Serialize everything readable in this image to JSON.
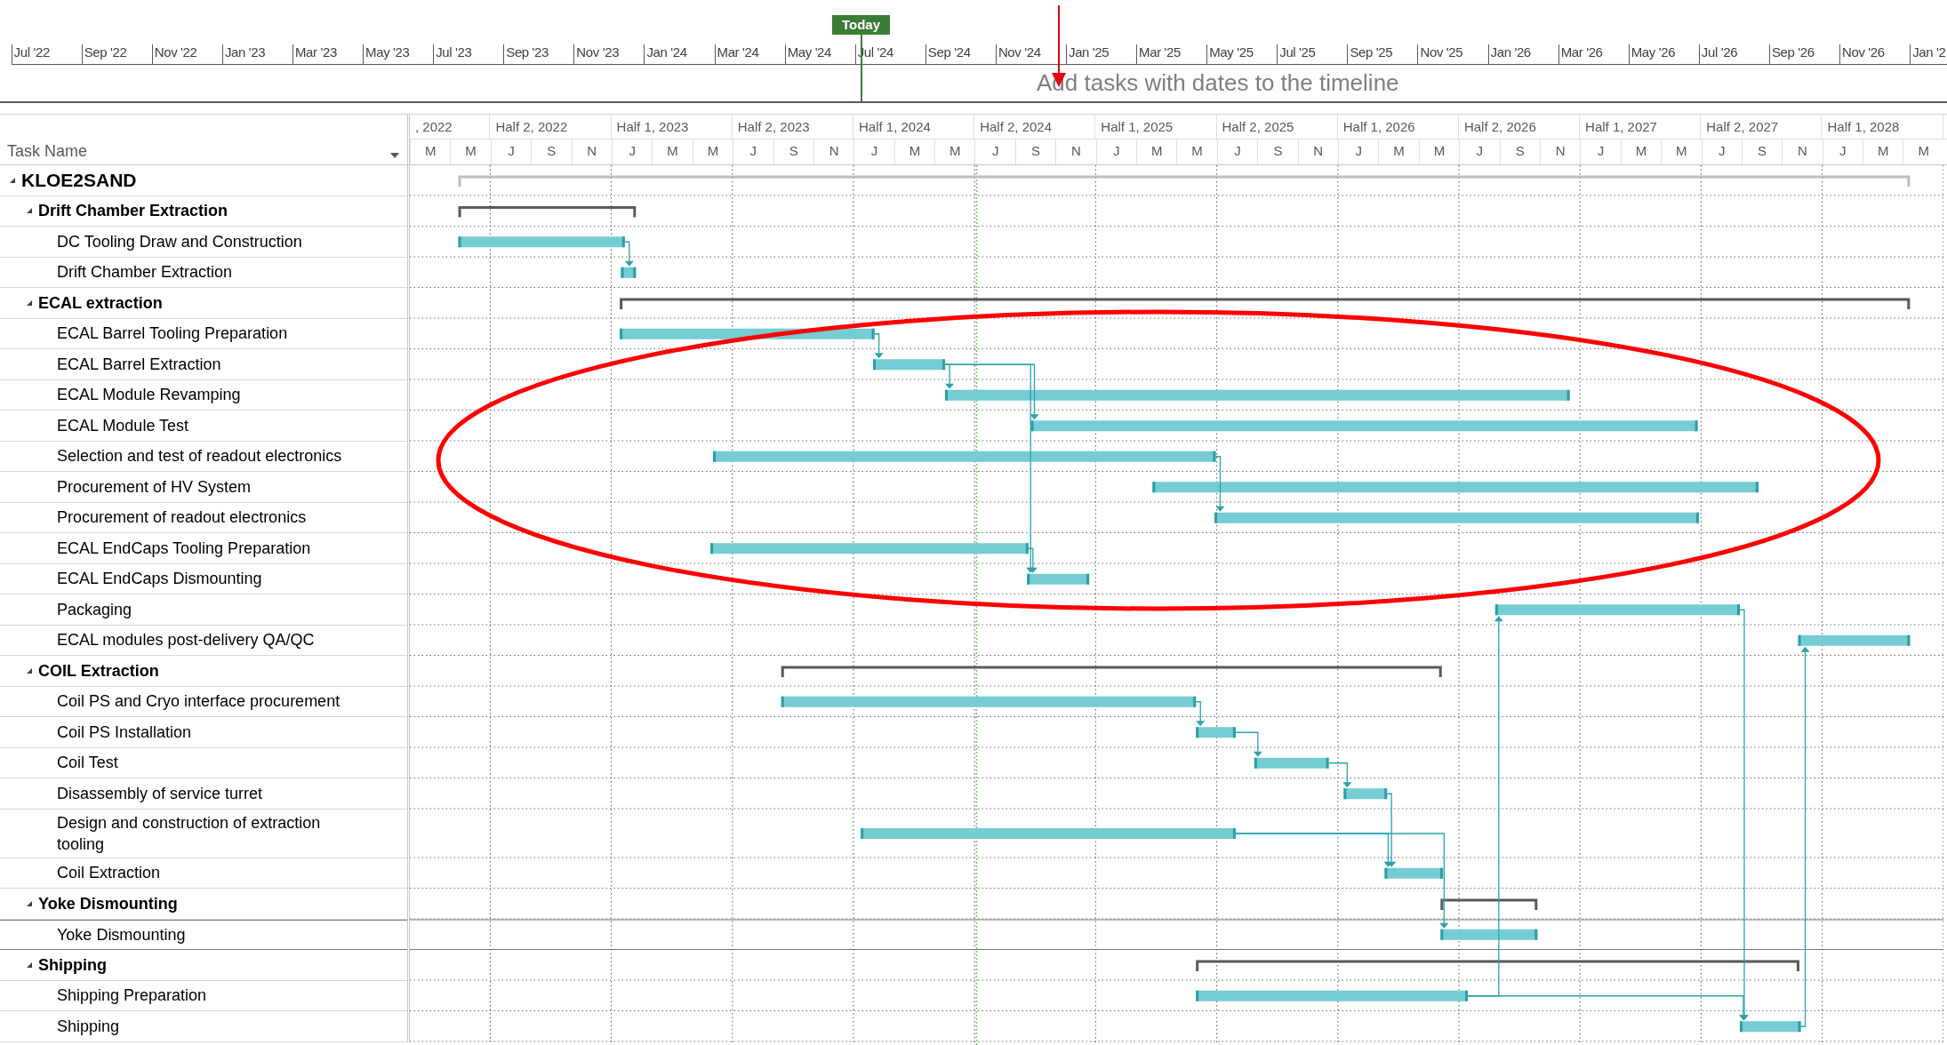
{
  "timeline": {
    "months": [
      "Jul '22",
      "Sep '22",
      "Nov '22",
      "Jan '23",
      "Mar '23",
      "May '23",
      "Jul '23",
      "Sep '23",
      "Nov '23",
      "Jan '24",
      "Mar '24",
      "May '24",
      "Jul '24",
      "Sep '24",
      "Nov '24",
      "Jan '25",
      "Mar '25",
      "May '25",
      "Jul '25",
      "Sep '25",
      "Nov '25",
      "Jan '26",
      "Mar '26",
      "May '26",
      "Jul '26",
      "Sep '26",
      "Nov '26",
      "Jan '2"
    ],
    "today_label": "Today",
    "hint": "Add tasks with dates to the timeline"
  },
  "header": {
    "task_name": "Task Name",
    "halves": [
      ", 2022",
      "Half 2, 2022",
      "Half 1, 2023",
      "Half 2, 2023",
      "Half 1, 2024",
      "Half 2, 2024",
      "Half 1, 2025",
      "Half 2, 2025",
      "Half 1, 2026",
      "Half 2, 2026",
      "Half 1, 2027",
      "Half 2, 2027",
      "Half 1, 2028"
    ],
    "months": [
      "M",
      "M",
      "J",
      "S",
      "N",
      "J",
      "M",
      "M",
      "J",
      "S",
      "N",
      "J",
      "M",
      "M",
      "J",
      "S",
      "N",
      "J",
      "M",
      "M",
      "J",
      "S",
      "N",
      "J",
      "M",
      "M",
      "J",
      "S",
      "N",
      "J",
      "M",
      "M",
      "J",
      "S",
      "N",
      "J",
      "M",
      "M"
    ]
  },
  "tasks": [
    {
      "name": "KLOE2SAND",
      "kind": "project",
      "expanded": true,
      "selected": false,
      "children": [
        {
          "name": "Drift Chamber Extraction",
          "kind": "summary",
          "expanded": true,
          "selected": false,
          "children": [
            {
              "name": "DC Tooling Draw and Construction",
              "kind": "task",
              "selected": false
            },
            {
              "name": "Drift Chamber Extraction",
              "kind": "task",
              "selected": false
            }
          ]
        },
        {
          "name": "ECAL extraction",
          "kind": "summary",
          "expanded": true,
          "selected": false,
          "children": [
            {
              "name": "ECAL Barrel Tooling Preparation",
              "kind": "task",
              "selected": false
            },
            {
              "name": "ECAL Barrel Extraction",
              "kind": "task",
              "selected": false
            },
            {
              "name": "ECAL Module Revamping",
              "kind": "task",
              "selected": false
            },
            {
              "name": "ECAL Module Test",
              "kind": "task",
              "selected": false
            },
            {
              "name": "Selection and test of readout electronics",
              "kind": "task",
              "selected": false
            },
            {
              "name": "Procurement of HV System",
              "kind": "task",
              "selected": false
            },
            {
              "name": "Procurement of readout electronics",
              "kind": "task",
              "selected": false
            },
            {
              "name": "ECAL EndCaps Tooling Preparation",
              "kind": "task",
              "selected": false
            },
            {
              "name": "ECAL EndCaps Dismounting",
              "kind": "task",
              "selected": false
            },
            {
              "name": "Packaging",
              "kind": "task",
              "selected": false
            },
            {
              "name": "ECAL modules post-delivery QA/QC",
              "kind": "task",
              "selected": false
            }
          ]
        },
        {
          "name": "COIL Extraction",
          "kind": "summary",
          "expanded": true,
          "selected": false,
          "children": [
            {
              "name": "Coil PS and Cryo interface procurement",
              "kind": "task",
              "selected": false
            },
            {
              "name": "Coil PS Installation",
              "kind": "task",
              "selected": false
            },
            {
              "name": "Coil Test",
              "kind": "task",
              "selected": false
            },
            {
              "name": "Disassembly of service turret",
              "kind": "task",
              "selected": false
            },
            {
              "name": "Design and construction of extraction tooling",
              "kind": "task",
              "selected": false
            },
            {
              "name": "Coil Extraction",
              "kind": "task",
              "selected": false
            }
          ]
        },
        {
          "name": "Yoke Dismounting",
          "kind": "summary",
          "expanded": true,
          "selected": false,
          "children": [
            {
              "name": "Yoke Dismounting",
              "kind": "task",
              "selected": true
            }
          ]
        },
        {
          "name": "Shipping",
          "kind": "summary",
          "expanded": true,
          "selected": false,
          "children": [
            {
              "name": "Shipping Preparation",
              "kind": "task",
              "selected": false
            },
            {
              "name": "Shipping",
              "kind": "task",
              "selected": false
            }
          ]
        }
      ]
    }
  ]
}
